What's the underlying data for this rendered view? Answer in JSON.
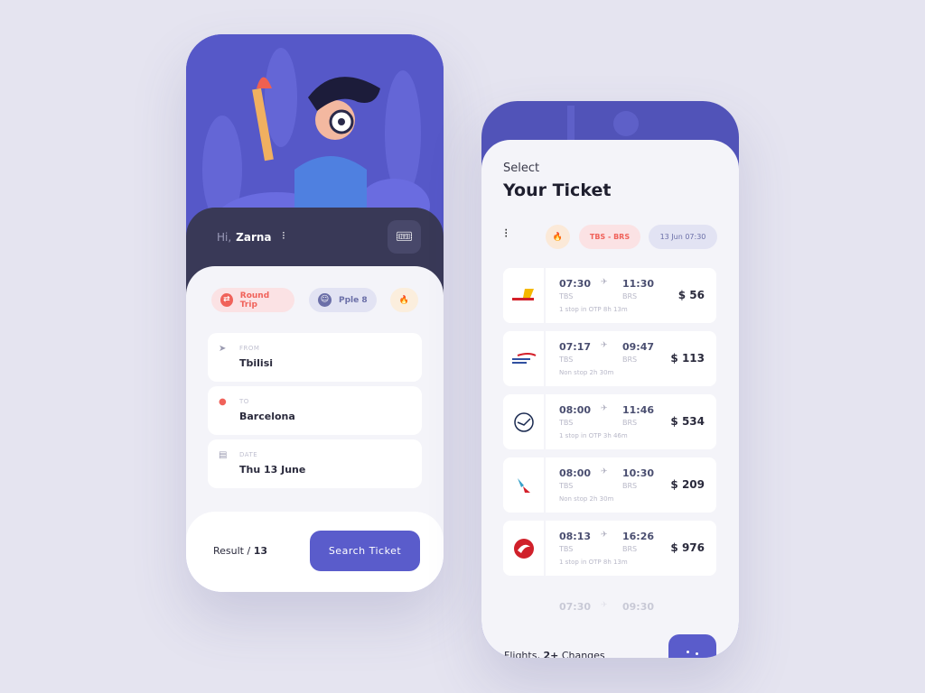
{
  "search_screen": {
    "greeting": "Hi,",
    "user_name": "Zarna",
    "chips": [
      {
        "label": "Round Trip",
        "icon": "swap-icon",
        "color": "#f0625a"
      },
      {
        "label": "Pple 8",
        "icon": "smiley-icon",
        "color": "#6b6fa8"
      },
      {
        "label": "",
        "icon": "fire-icon",
        "color": "#f5a742"
      }
    ],
    "fields": [
      {
        "label": "FROM",
        "value": "Tbilisi",
        "icon": "navigation-arrow-icon"
      },
      {
        "label": "TO",
        "value": "Barcelona",
        "icon": "location-pin-icon"
      },
      {
        "label": "DATE",
        "value": "Thu 13 June",
        "icon": "calendar-icon"
      }
    ],
    "result_label": "Result /",
    "result_count": "13",
    "search_button": "Search Ticket"
  },
  "results_screen": {
    "subtitle": "Select",
    "title": "Your Ticket",
    "filters": {
      "route": "TBS - BRS",
      "datetime": "13 Jun 07:30"
    },
    "flights": [
      {
        "airline": "Pegasus",
        "dep": "07:30",
        "arr": "11:30",
        "from": "TBS",
        "to": "BRS",
        "info": "1 stop in OTP  8h 13m",
        "price": "$ 56"
      },
      {
        "airline": "British Airways",
        "dep": "07:17",
        "arr": "09:47",
        "from": "TBS",
        "to": "BRS",
        "info": "Non stop  2h 30m",
        "price": "$ 113"
      },
      {
        "airline": "Lufthansa",
        "dep": "08:00",
        "arr": "11:46",
        "from": "TBS",
        "to": "BRS",
        "info": "1 stop in OTP  3h 46m",
        "price": "$ 534"
      },
      {
        "airline": "American Airlines",
        "dep": "08:00",
        "arr": "10:30",
        "from": "TBS",
        "to": "BRS",
        "info": "Non stop  2h 30m",
        "price": "$ 209"
      },
      {
        "airline": "Turkish Airlines",
        "dep": "08:13",
        "arr": "16:26",
        "from": "TBS",
        "to": "BRS",
        "info": "1 stop in OTP  8h 13m",
        "price": "$ 976"
      },
      {
        "dep": "07:30",
        "arr": "09:30"
      }
    ],
    "footer_prefix": "Flights,",
    "footer_bold": "2+",
    "footer_suffix": "Changes",
    "brand_labels": {
      "pegasus": "PEGASUS",
      "ba": "BRITISH AIRWAYS"
    }
  }
}
